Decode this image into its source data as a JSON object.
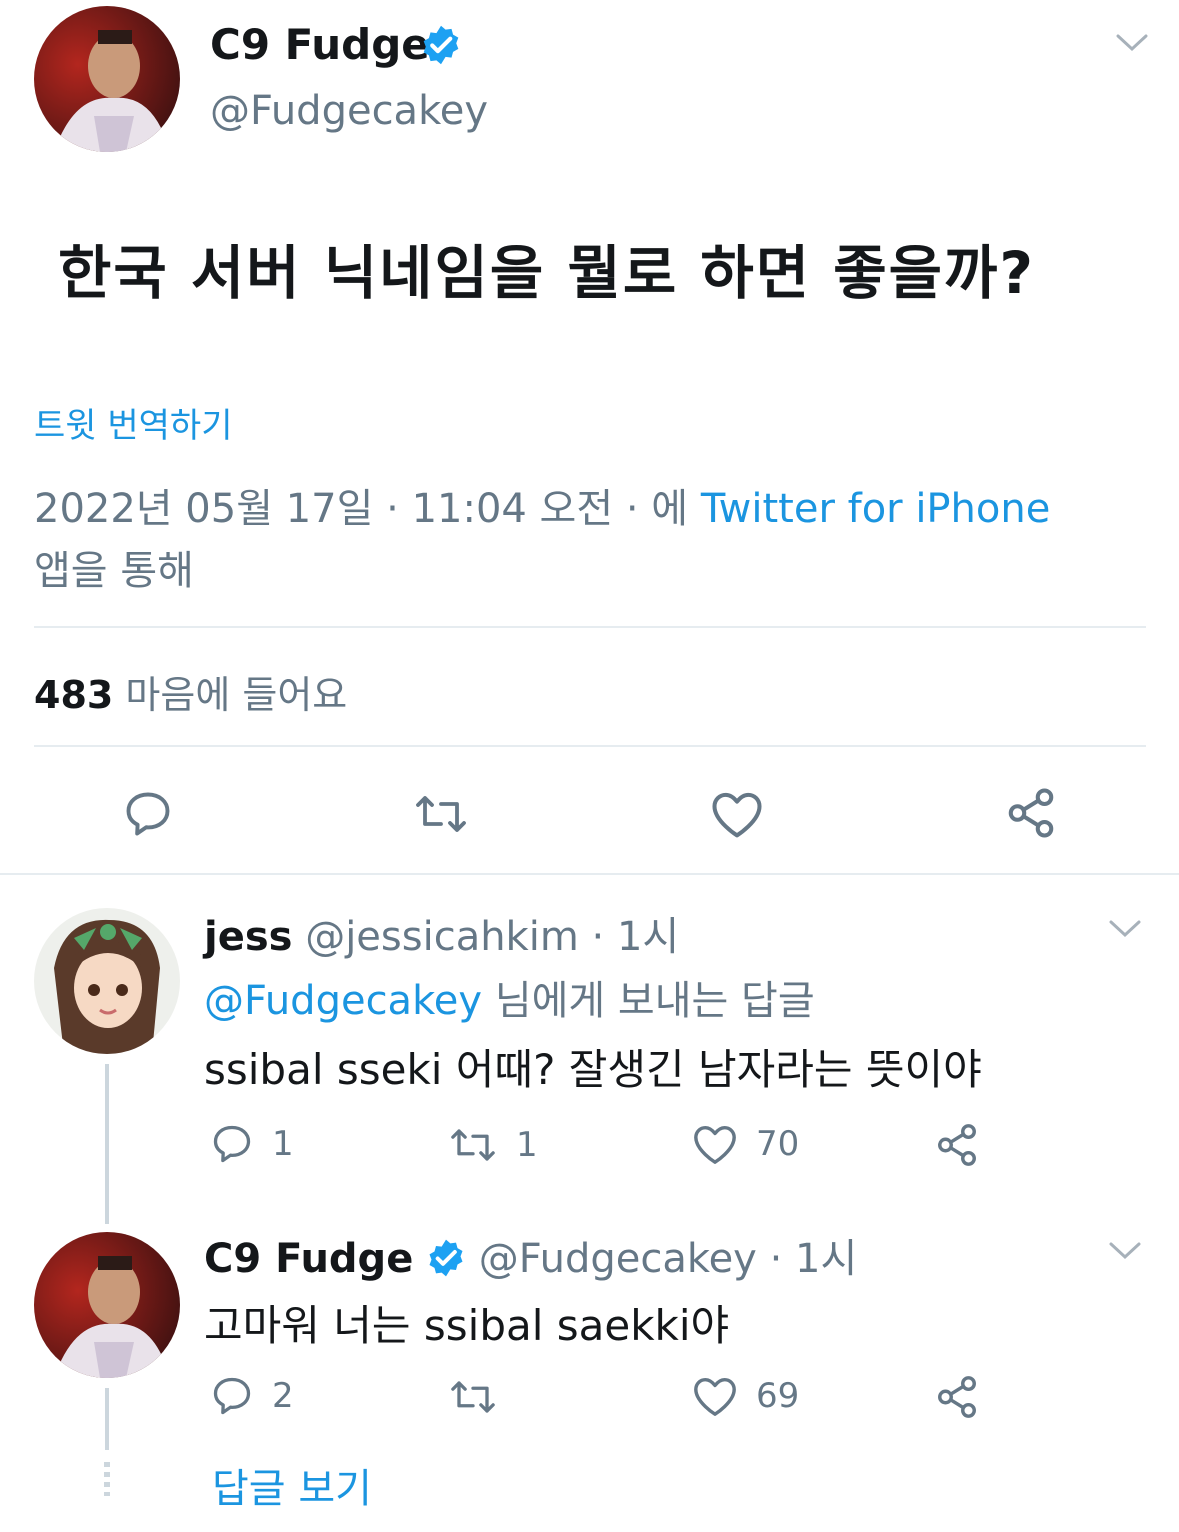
{
  "main_tweet": {
    "author_name": "C9 Fudge",
    "author_handle": "@Fudgecakey",
    "text": "한국 서버 닉네임을 뭘로 하면 좋을까?",
    "translate_label": "트윗 번역하기",
    "timestamp": "2022년 05월 17일 · 11:04 오전 · 에",
    "source_app": "Twitter for iPhone",
    "source_suffix": "앱을 통해",
    "likes_count": "483",
    "likes_label": "마음에 들어요"
  },
  "replies": [
    {
      "author_name": "jess",
      "author_handle": "@jessicahkim",
      "time": "· 1시",
      "reply_to_handle": "@Fudgecakey",
      "reply_to_suffix": "님에게 보내는 답글",
      "text": "ssibal sseki 어때? 잘생긴 남자라는 뜻이야",
      "reply_count": "1",
      "retweet_count": "1",
      "like_count": "70"
    },
    {
      "author_name": "C9 Fudge",
      "author_handle": "@Fudgecakey",
      "time": "· 1시",
      "text": "고마워 너는 ssibal saekki야",
      "reply_count": "2",
      "retweet_count": "",
      "like_count": "69"
    }
  ],
  "show_replies_label": "답글 보기",
  "colors": {
    "accent": "#1b95e0",
    "muted": "#657786",
    "verified": "#1da1f2"
  }
}
